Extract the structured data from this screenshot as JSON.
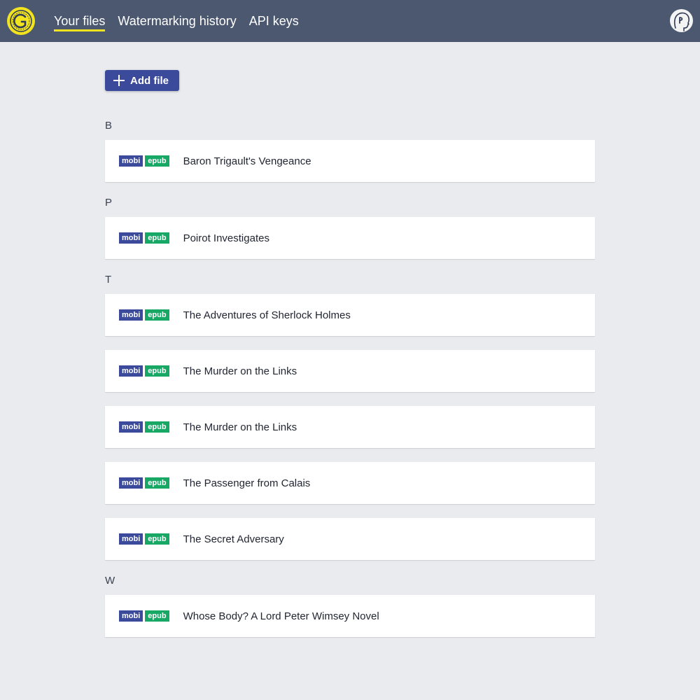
{
  "header": {
    "nav": [
      {
        "label": "Your files",
        "active": true
      },
      {
        "label": "Watermarking history",
        "active": false
      },
      {
        "label": "API keys",
        "active": false
      }
    ]
  },
  "toolbar": {
    "add_file_label": "Add file"
  },
  "badges": {
    "mobi": "mobi",
    "epub": "epub"
  },
  "groups": [
    {
      "letter": "B",
      "files": [
        {
          "title": "Baron Trigault's Vengeance"
        }
      ]
    },
    {
      "letter": "P",
      "files": [
        {
          "title": "Poirot Investigates"
        }
      ]
    },
    {
      "letter": "T",
      "files": [
        {
          "title": "The Adventures of Sherlock Holmes"
        },
        {
          "title": "The Murder on the Links"
        },
        {
          "title": "The Murder on the Links"
        },
        {
          "title": "The Passenger from Calais"
        },
        {
          "title": "The Secret Adversary"
        }
      ]
    },
    {
      "letter": "W",
      "files": [
        {
          "title": "Whose Body? A Lord Peter Wimsey Novel"
        }
      ]
    }
  ],
  "colors": {
    "header_bg": "#4b5870",
    "accent_yellow": "#f2e31f",
    "button_blue": "#3b4a9a",
    "badge_mobi": "#3b4a9a",
    "badge_epub": "#17a865",
    "page_bg": "#e9ebef"
  },
  "icons": {
    "logo": "brand-logo-icon",
    "avatar": "user-avatar-icon",
    "add": "plus-icon"
  }
}
